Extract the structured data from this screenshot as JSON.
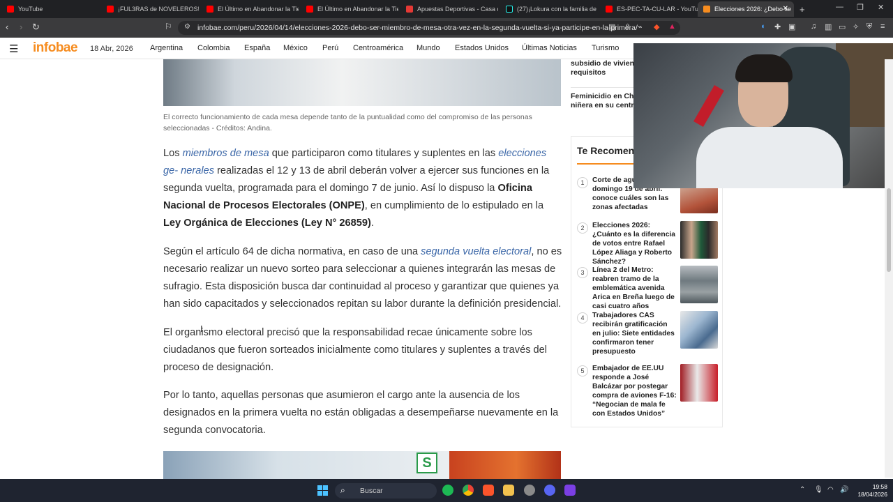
{
  "browser": {
    "tabs": [
      {
        "title": "YouTube",
        "color": "#ff0000"
      },
      {
        "title": "¡FUL3RAS de NOVELEROS!",
        "color": "#ff0000"
      },
      {
        "title": "El Último en Abandonar la Tie",
        "color": "#ff0000"
      },
      {
        "title": "El Último en Abandonar la Tie",
        "color": "#ff0000"
      },
      {
        "title": "Apuestas Deportivas - Casa de",
        "color": "#e53935"
      },
      {
        "title": "(27)¡Lokura con la familia de A",
        "color": "#111111"
      },
      {
        "title": "ES-PEC-TA-CU-LAR - YouTube",
        "color": "#ff0000"
      },
      {
        "title": "Elecciones 2026: ¿Debo se",
        "color": "#f68c1f"
      }
    ],
    "new_tab": "+",
    "url": "infobae.com/peru/2026/04/14/elecciones-2026-debo-ser-miembro-de-mesa-otra-vez-en-la-segunda-vuelta-si-ya-participe-en-la-primera/"
  },
  "site": {
    "logo": "infobae",
    "date": "18 Abr, 2026",
    "nav": [
      "Argentina",
      "Colombia",
      "España",
      "México",
      "Perú",
      "Centroamérica",
      "Mundo",
      "Estados Unidos",
      "Últimas Noticias",
      "Turismo"
    ]
  },
  "article": {
    "caption": "El correcto funcionamiento de cada mesa depende tanto de la puntualidad como del compromiso de las personas seleccionadas - Créditos: Andina.",
    "p1": {
      "t1": "Los ",
      "l1": "miembros de mesa",
      "t2": " que participaron como titulares y suplentes en las ",
      "l2": "elecciones ge-\nnerales",
      "t3": " realizadas el 12 y 13 de abril deberán volver a ejercer sus funciones en la segunda vuelta, programada para el domingo 7 de junio. Así lo dispuso la ",
      "b1": "Oficina Nacional de Procesos Electorales (ONPE)",
      "t4": ", en cumplimiento de lo estipulado en la ",
      "b2": "Ley Orgánica de Elecciones (Ley N° 26859)",
      "t5": "."
    },
    "p2": {
      "t1": "Según el artículo 64 de dicha normativa, en caso de una ",
      "l1": "segunda vuelta electoral",
      "t2": ", no es necesario realizar un nuevo sorteo para seleccionar a quienes integrarán las mesas de sufragio. Esta disposición busca dar continuidad al proceso y garantizar que quienes ya han sido capacitados y seleccionados repitan su labor durante la definición presidencial."
    },
    "p3": "El organismo electoral precisó que la responsabilidad recae únicamente sobre los ciudadanos que fueron sorteados inicialmente como titulares y suplentes a través del proceso de designación.",
    "p4": "Por lo tanto, aquellas personas que asumieron el cargo ante la ausencia de los designados en la primera vuelta no están obligadas a desempeñarse nuevamente en la segunda convocatoria.",
    "image2_sign": "S"
  },
  "sidebar": {
    "top_items": [
      "subsidio de vivien\nrequisitos",
      "Feminicidio en Chi\nniñera en su centro"
    ],
    "recommend_title": "Te Recomen",
    "recommendations": [
      {
        "num": "1",
        "text": "Corte de agua\ndomingo 19 de abril:\nconoce cuáles son las\nzonas afectadas"
      },
      {
        "num": "2",
        "text": "Elecciones 2026: ¿Cuánto es la diferencia de votos entre Rafael López Aliaga y Roberto Sánchez?"
      },
      {
        "num": "3",
        "text": "Línea 2 del Metro: reabren tramo de la emblemática avenida Arica en Breña luego de casi cuatro años"
      },
      {
        "num": "4",
        "text": "Trabajadores CAS recibirán gratificación en julio: Siete entidades confirmaron tener presupuesto"
      },
      {
        "num": "5",
        "text": "Embajador de EE.UU responde a José Balcázar por postegar compra de aviones F-16: “Negocian de mala fe con Estados Unidos”"
      }
    ]
  },
  "taskbar": {
    "search": "Buscar",
    "time": "19:58",
    "date": "18/04/2026"
  }
}
